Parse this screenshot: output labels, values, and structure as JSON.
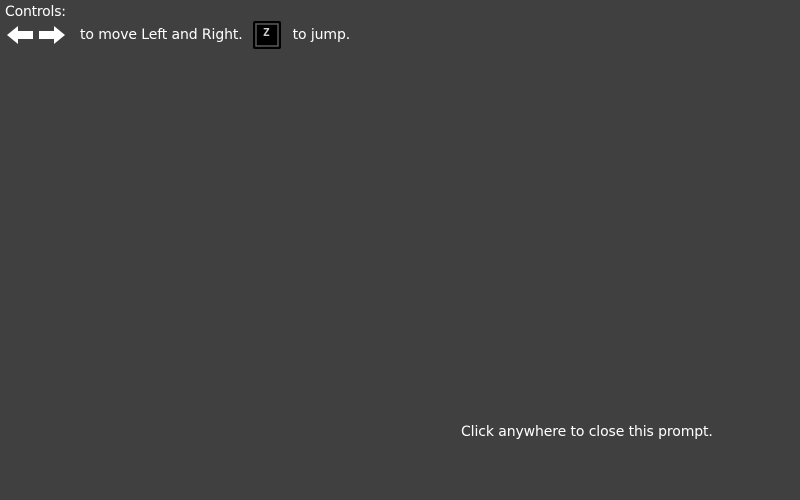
{
  "controls": {
    "title": "Controls:",
    "move_text": "to move Left and Right.",
    "jump_text": "to jump.",
    "left_icon": "left-arrow-key-icon",
    "right_icon": "right-arrow-key-icon",
    "jump_key_icon": "z-key-icon",
    "jump_key_letter": "Z"
  },
  "prompt": {
    "close_text": "Click anywhere to close this prompt."
  },
  "colors": {
    "background": "#404040",
    "text": "#ffffff",
    "key_background": "#000000",
    "key_letter": "#cfcfcf"
  }
}
